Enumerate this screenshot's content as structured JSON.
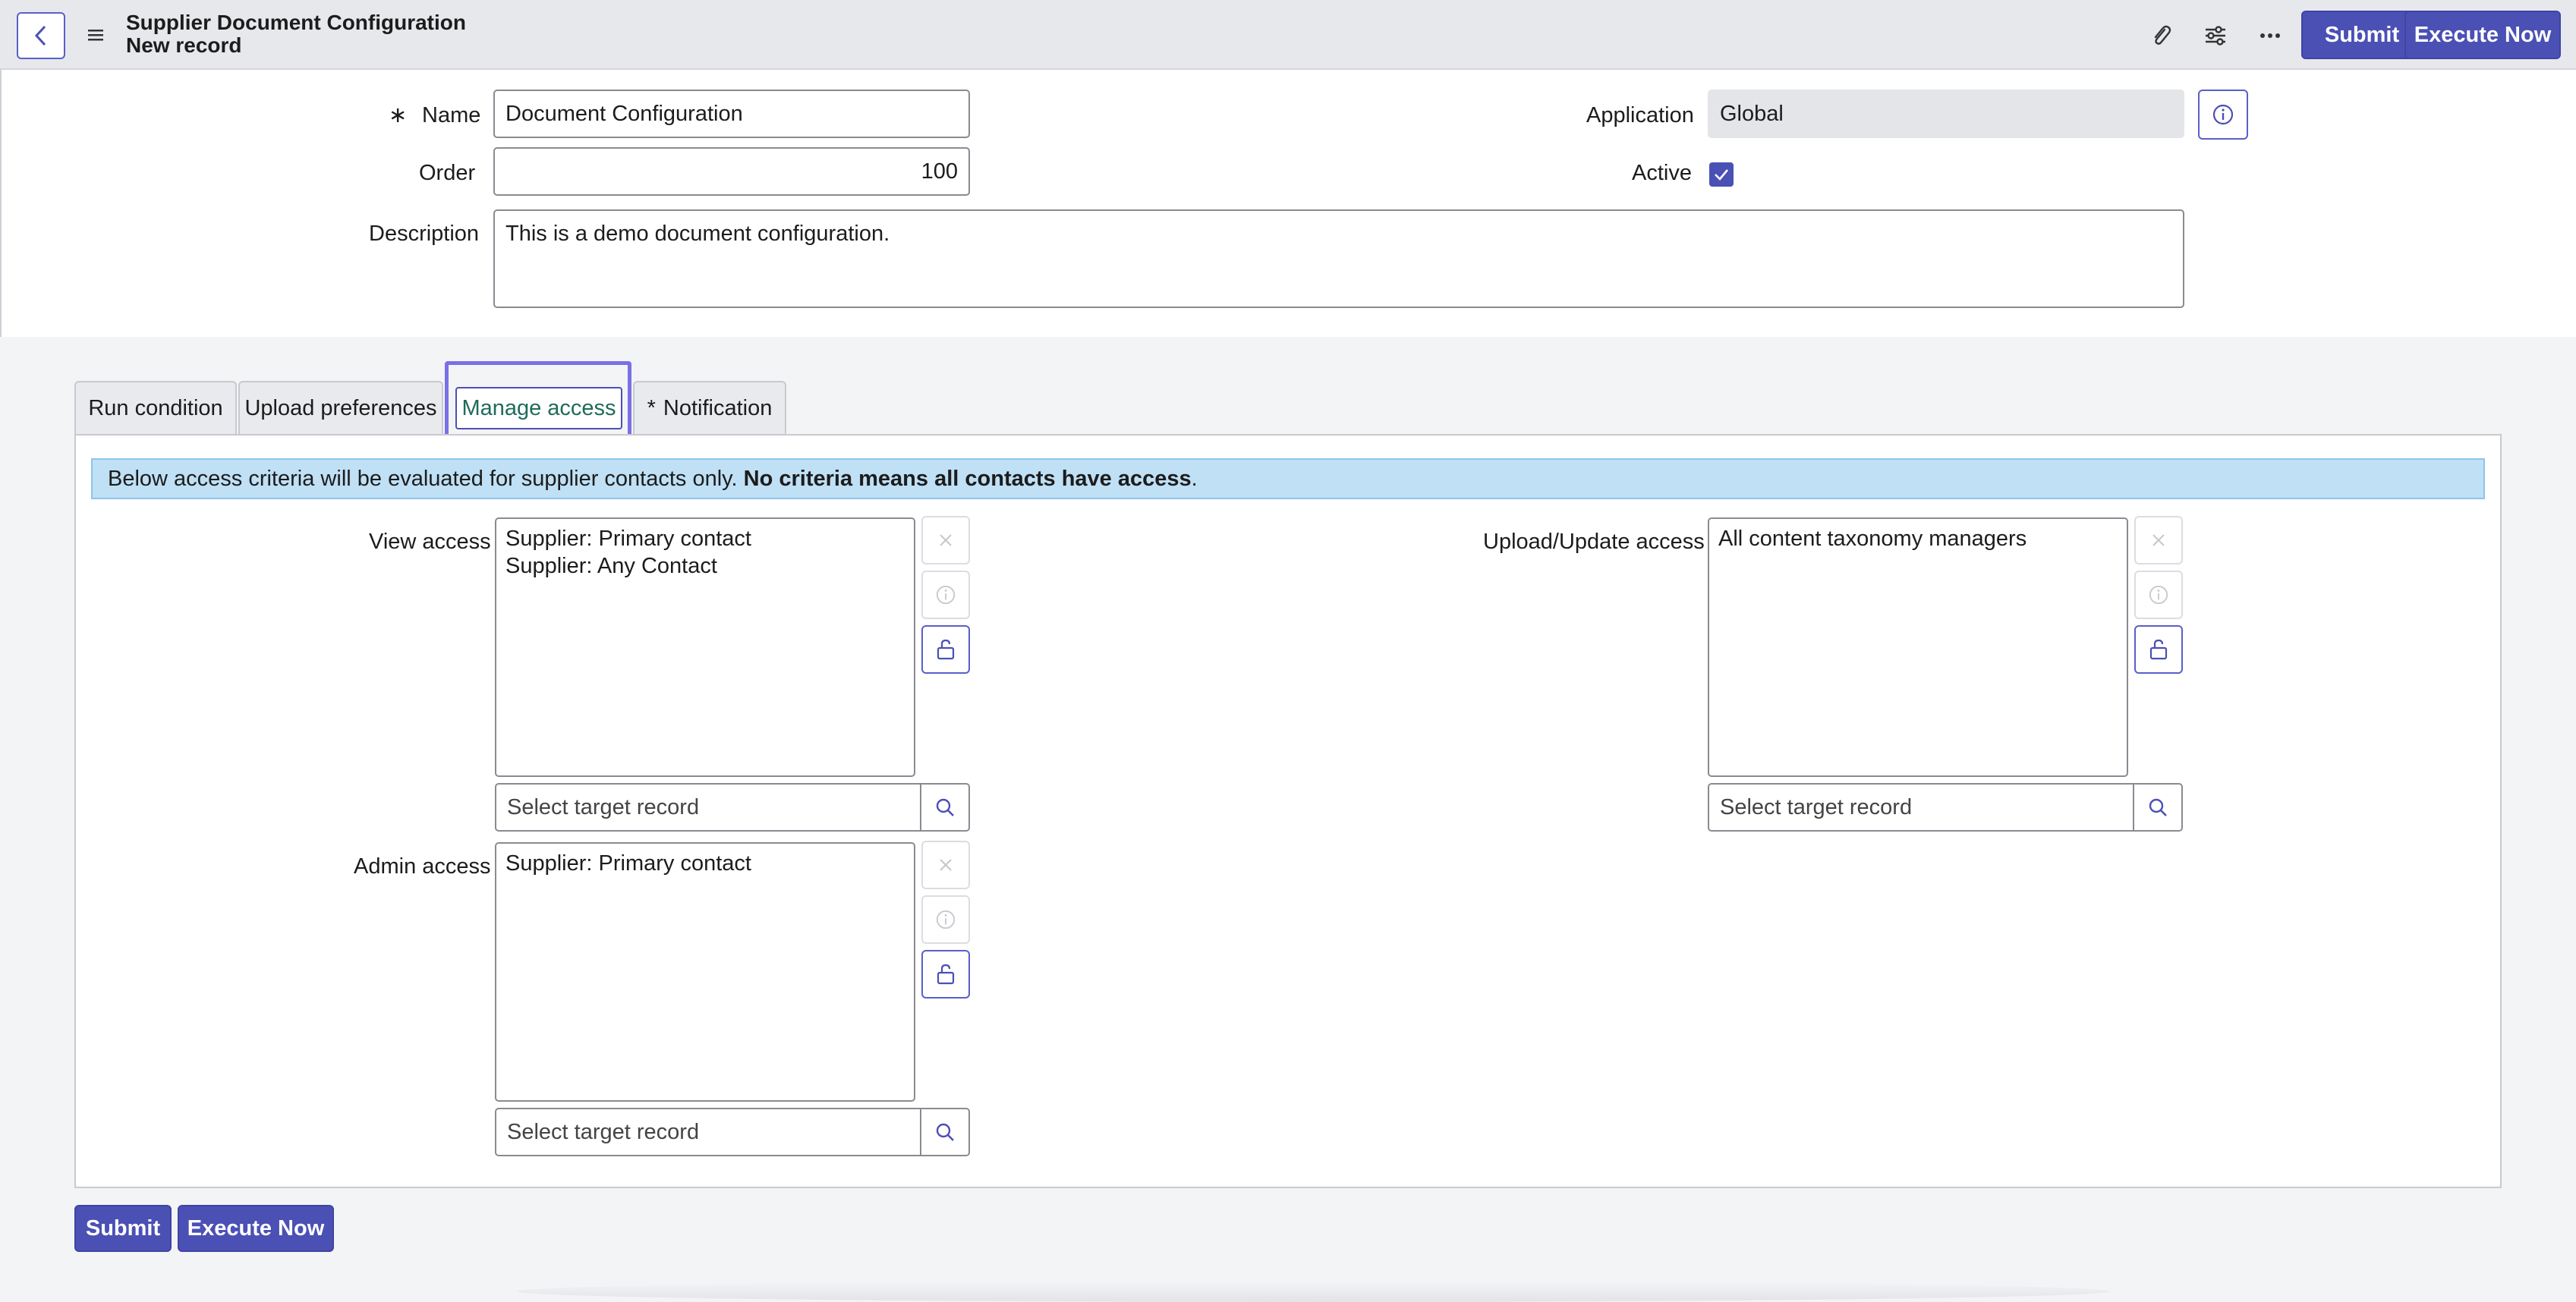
{
  "header": {
    "title": "Supplier Document Configuration",
    "subtitle": "New record",
    "submit_label": "Submit",
    "execute_label": "Execute Now",
    "icons": [
      "back-icon",
      "menu-icon",
      "paperclip-icon",
      "sliders-icon",
      "more-icon"
    ]
  },
  "form": {
    "name_required_mark": "∗",
    "name_label": "Name",
    "name_value": "Document Configuration",
    "order_label": "Order",
    "order_value": "100",
    "description_label": "Description",
    "description_value": "This is a demo document configuration.",
    "application_label": "Application",
    "application_value": "Global",
    "active_label": "Active",
    "active_checked": true
  },
  "tabs": [
    {
      "label": "Run condition",
      "active": false
    },
    {
      "label": "Upload preferences",
      "active": false
    },
    {
      "label": "Manage access",
      "active": true
    },
    {
      "label": "Notification",
      "active": false,
      "required_mark": "*"
    }
  ],
  "banner": {
    "text_plain": "Below access criteria will be evaluated for supplier contacts only.",
    "text_bold": "No criteria means all contacts have access",
    "text_end": "."
  },
  "access": {
    "view": {
      "label": "View access",
      "items": [
        "Supplier: Primary contact",
        "Supplier: Any Contact"
      ],
      "placeholder": "Select target record"
    },
    "upload": {
      "label": "Upload/Update access",
      "items": [
        "All content taxonomy managers"
      ],
      "placeholder": "Select target record"
    },
    "admin": {
      "label": "Admin access",
      "items": [
        "Supplier: Primary contact"
      ],
      "placeholder": "Select target record"
    }
  },
  "footer": {
    "submit_label": "Submit",
    "execute_label": "Execute Now"
  },
  "colors": {
    "primary": "#4b50b5",
    "focus": "#7a6fe6",
    "banner": "#bfe0f5",
    "active_tab_text": "#1f6b5a"
  }
}
